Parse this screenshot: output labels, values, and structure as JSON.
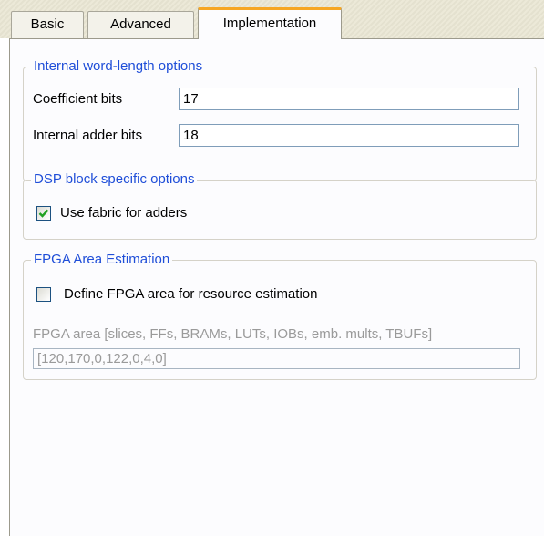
{
  "tabs": [
    {
      "label": "Basic"
    },
    {
      "label": "Advanced"
    },
    {
      "label": "Implementation"
    }
  ],
  "internal_wordlength": {
    "title": "Internal word-length options",
    "coefficient_bits_label": "Coefficient bits",
    "coefficient_bits_value": "17",
    "internal_adder_bits_label": "Internal adder bits",
    "internal_adder_bits_value": "18"
  },
  "dsp_block": {
    "title": "DSP block specific options",
    "use_fabric_label": "Use fabric for adders",
    "use_fabric_checked": true
  },
  "fpga_area": {
    "title": "FPGA Area Estimation",
    "define_area_label": "Define FPGA area for resource estimation",
    "define_area_checked": false,
    "area_field_label": "FPGA area [slices, FFs, BRAMs, LUTs, IOBs, emb. mults, TBUFs]",
    "area_field_value": "[120,170,0,122,0,4,0]"
  },
  "colors": {
    "group_title": "#1f4ed8",
    "active_tab_accent": "#f6a623",
    "checkmark": "#21a121",
    "disabled_text": "#9a9a9a"
  }
}
